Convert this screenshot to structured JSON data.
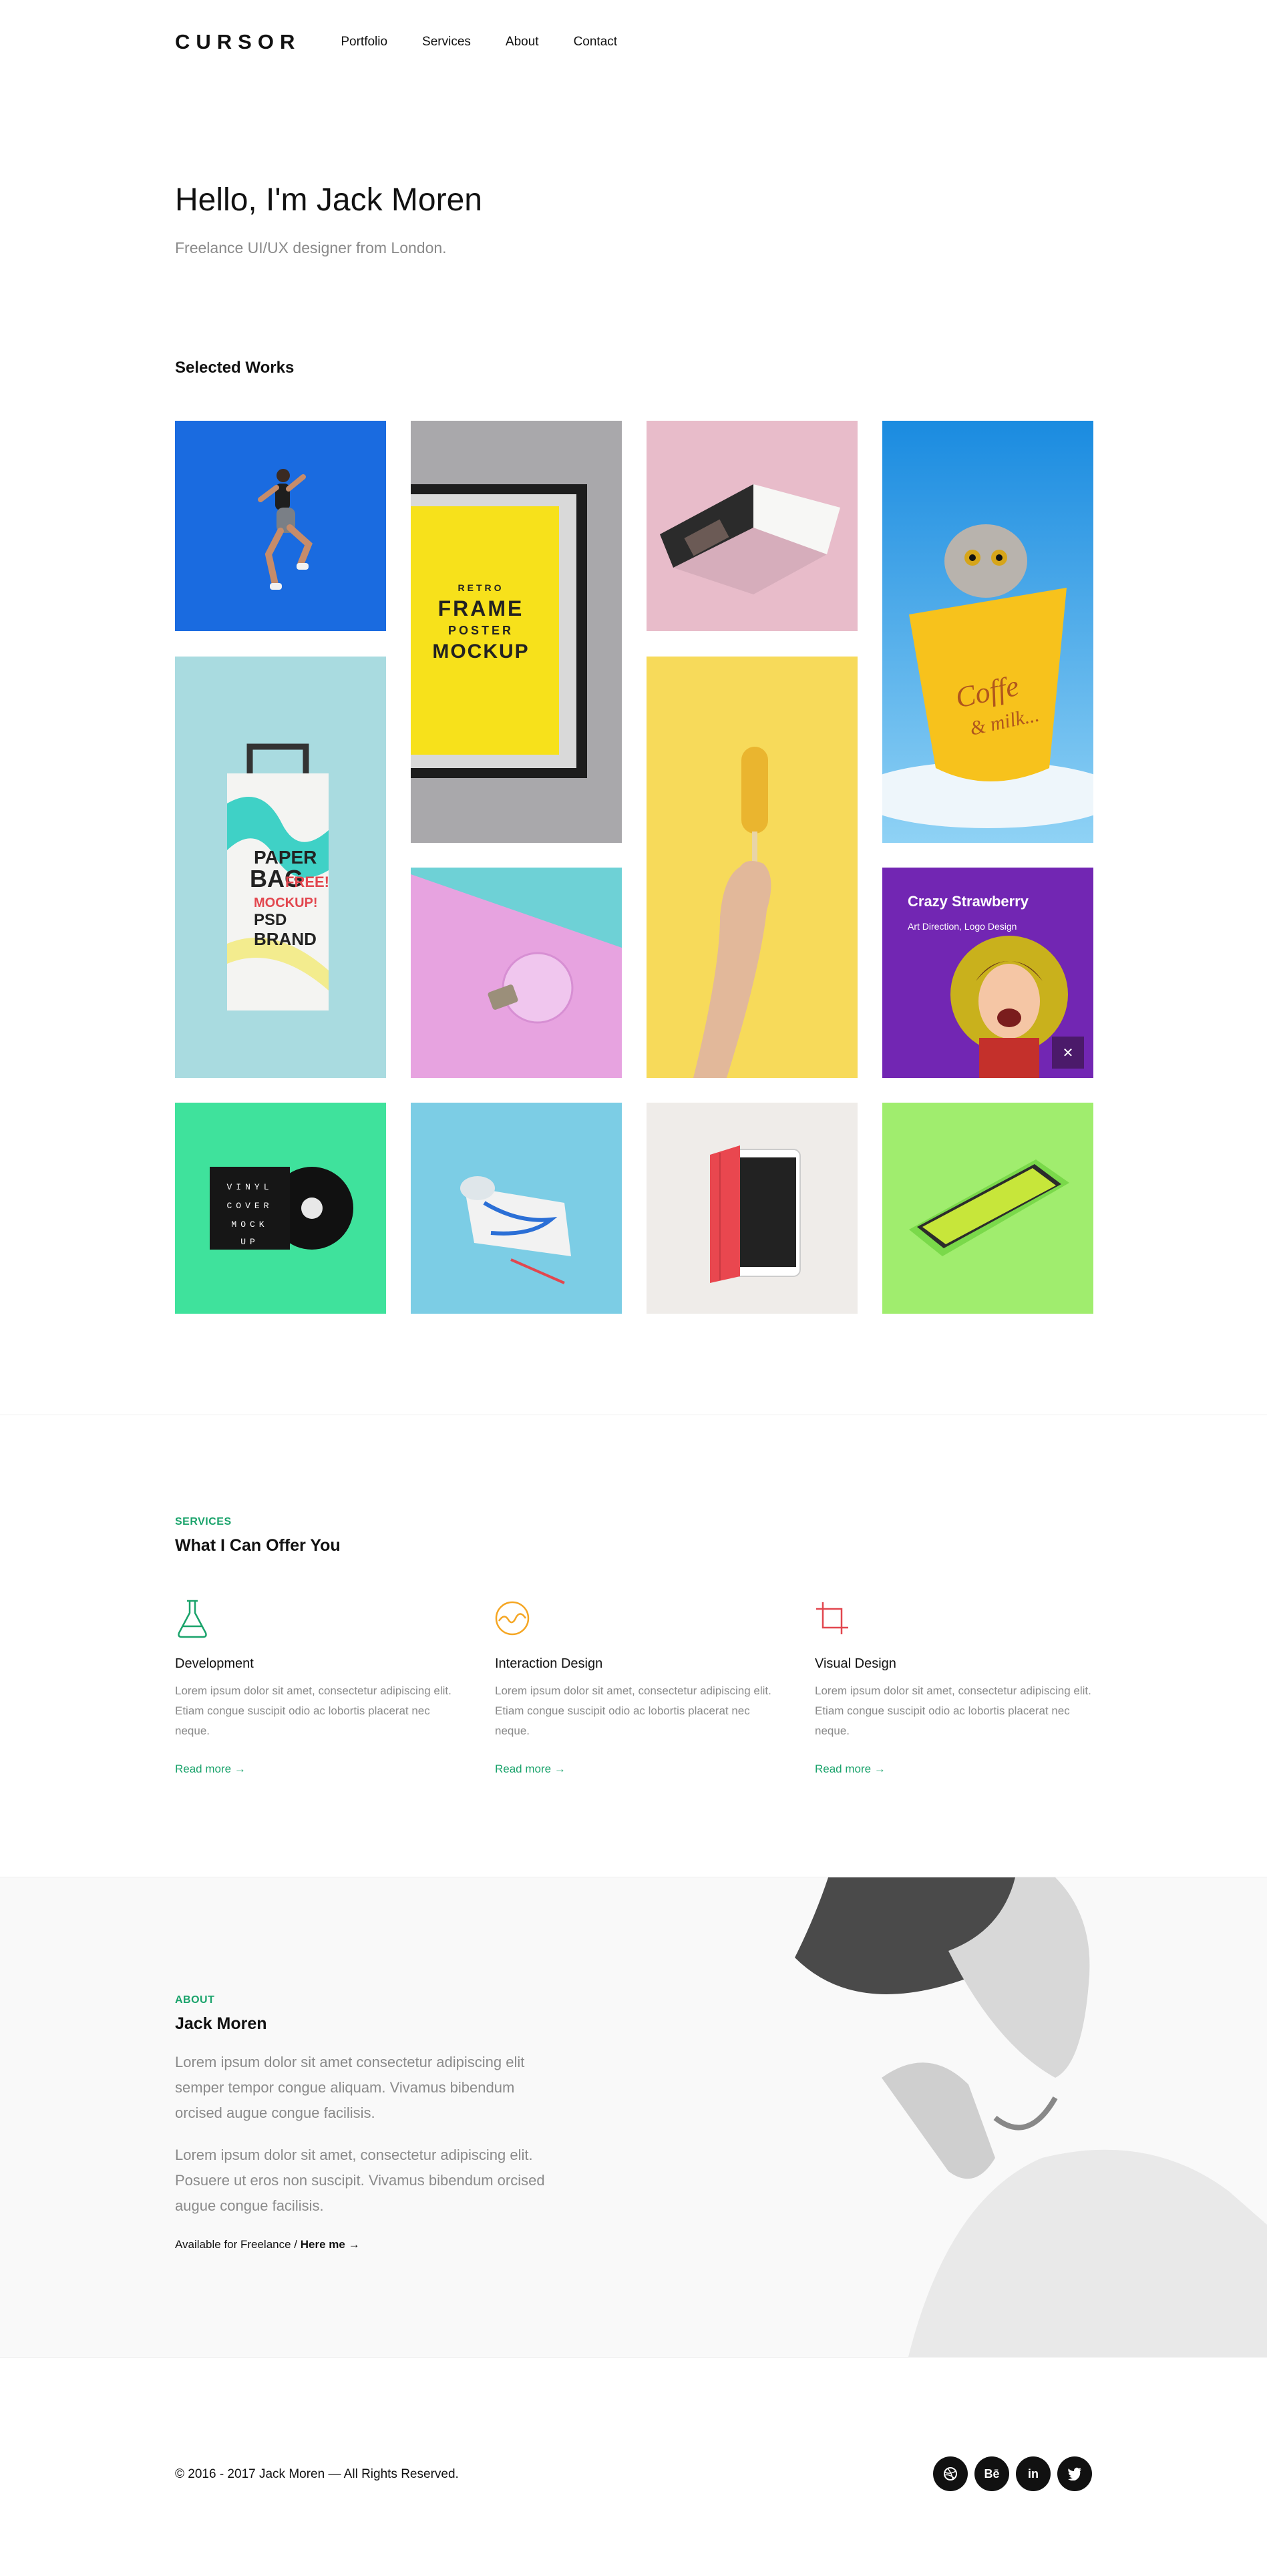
{
  "header": {
    "logo": "CURSOR",
    "nav": [
      "Portfolio",
      "Services",
      "About",
      "Contact"
    ]
  },
  "hero": {
    "title": "Hello, I'm Jack Moren",
    "subtitle": "Freelance UI/UX designer from London."
  },
  "works": {
    "title": "Selected Works",
    "overlay": {
      "title": "Crazy Strawberry",
      "subtitle": "Art Direction, Logo Design"
    },
    "artwork_text": {
      "frame": [
        "RETRO",
        "FRAME",
        "POSTER",
        "MOCKUP"
      ],
      "bag": [
        "PAPER",
        "BAG",
        "FREE!",
        "MOCKUP!",
        "PSD",
        "BRAND"
      ],
      "coffee": [
        "Coffe",
        "& milk..."
      ],
      "vinyl": [
        "VINYL",
        "COVER",
        "MOCK",
        "UP"
      ]
    }
  },
  "services": {
    "eyebrow": "SERVICES",
    "title": "What I Can Offer You",
    "items": [
      {
        "title": "Development",
        "desc": "Lorem ipsum dolor sit amet, consectetur adipiscing elit. Etiam congue suscipit odio ac lobortis placerat nec neque.",
        "link": "Read more",
        "icon": "flask-icon",
        "color": "#1aa36b"
      },
      {
        "title": "Interaction Design",
        "desc": "Lorem ipsum dolor sit amet, consectetur adipiscing elit. Etiam congue suscipit odio ac lobortis placerat nec neque.",
        "link": "Read more",
        "icon": "wave-circle-icon",
        "color": "#f5a623"
      },
      {
        "title": "Visual Design",
        "desc": "Lorem ipsum dolor sit amet, consectetur adipiscing elit. Etiam congue suscipit odio ac lobortis placerat nec neque.",
        "link": "Read more",
        "icon": "crop-icon",
        "color": "#e2474f"
      }
    ]
  },
  "about": {
    "eyebrow": "ABOUT",
    "name": "Jack Moren",
    "p1": "Lorem ipsum dolor sit amet consectetur adipiscing elit semper tempor congue aliquam. Vivamus bibendum orcised augue congue facilisis.",
    "p2": "Lorem ipsum dolor sit amet, consectetur adipiscing elit. Posuere ut eros non suscipit. Vivamus bibendum orcised augue congue facilisis.",
    "freelance_prefix": "Available for Freelance / ",
    "freelance_link": "Here me"
  },
  "footer": {
    "copyright": "© 2016 - 2017 Jack Moren — All Rights Reserved.",
    "socials": [
      "dribbble-icon",
      "behance-icon",
      "linkedin-icon",
      "twitter-icon"
    ],
    "social_labels": {
      "behance": "Bē",
      "linkedin": "in"
    }
  },
  "colors": {
    "accent": "#1aa36b",
    "tile_blue": "#1a6be0",
    "tile_gray": "#a9a8ab",
    "tile_pink": "#e8bcca",
    "tile_sky": "#3aa5e6",
    "tile_aqua": "#a9dbe0",
    "tile_yellow": "#f7da5a",
    "tile_magenta": "#e7a3e0",
    "tile_purple": "#7226b3",
    "tile_mint": "#3fe29c",
    "tile_lightblue": "#7ccde5",
    "tile_beige": "#efece9",
    "tile_lime": "#a0ed6e"
  }
}
